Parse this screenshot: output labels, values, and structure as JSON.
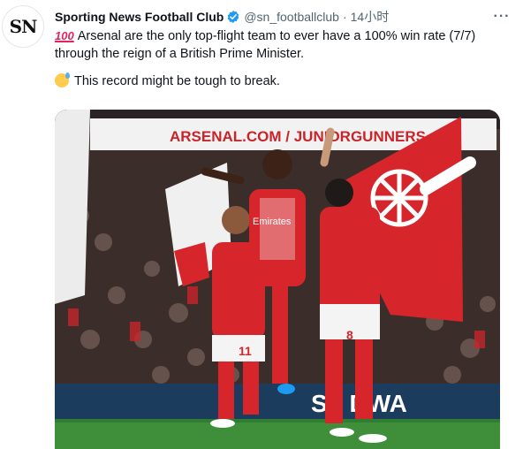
{
  "tweet": {
    "avatar_text": "SN",
    "display_name": "Sporting News Football Club",
    "verified": true,
    "handle": "@sn_footballclub",
    "separator": "·",
    "time": "14小时",
    "more_label": "···",
    "text_line1": "Arsenal are the only top-flight team to ever have a 100% win rate (7/7)",
    "text_line2": "through the reign of a British Prime Minister.",
    "text_line3": "This record might be tough to break.",
    "emoji1": "💯",
    "emoji2": "sweat-smile-emoji"
  },
  "photo": {
    "banner_text": "ARSENAL.COM / JUNIORGUNNERS",
    "board_text": "ST  DWA",
    "player_number_left": "11",
    "player_number_right": "8",
    "shirt_sponsor": "Emirates",
    "colors": {
      "arsenal_red": "#d7262b",
      "pitch": "#2f7d32",
      "crowd": "#3a2b27",
      "verified_blue": "#1d9bf0"
    }
  }
}
